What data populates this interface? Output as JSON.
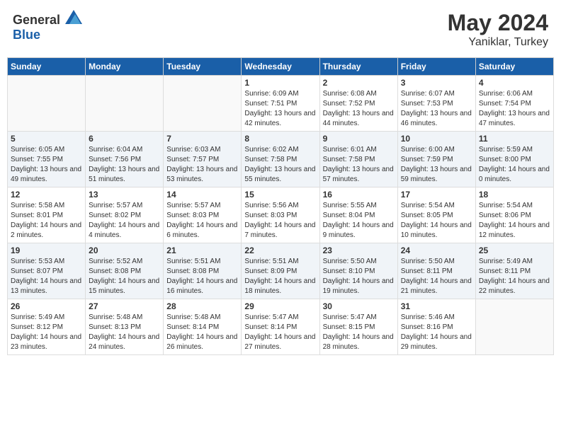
{
  "header": {
    "logo_general": "General",
    "logo_blue": "Blue",
    "month_year": "May 2024",
    "location": "Yaniklar, Turkey"
  },
  "days_of_week": [
    "Sunday",
    "Monday",
    "Tuesday",
    "Wednesday",
    "Thursday",
    "Friday",
    "Saturday"
  ],
  "weeks": [
    {
      "cells": [
        {
          "day": "",
          "empty": true
        },
        {
          "day": "",
          "empty": true
        },
        {
          "day": "",
          "empty": true
        },
        {
          "day": "1",
          "sunrise": "6:09 AM",
          "sunset": "7:51 PM",
          "daylight": "13 hours and 42 minutes."
        },
        {
          "day": "2",
          "sunrise": "6:08 AM",
          "sunset": "7:52 PM",
          "daylight": "13 hours and 44 minutes."
        },
        {
          "day": "3",
          "sunrise": "6:07 AM",
          "sunset": "7:53 PM",
          "daylight": "13 hours and 46 minutes."
        },
        {
          "day": "4",
          "sunrise": "6:06 AM",
          "sunset": "7:54 PM",
          "daylight": "13 hours and 47 minutes."
        }
      ]
    },
    {
      "cells": [
        {
          "day": "5",
          "sunrise": "6:05 AM",
          "sunset": "7:55 PM",
          "daylight": "13 hours and 49 minutes."
        },
        {
          "day": "6",
          "sunrise": "6:04 AM",
          "sunset": "7:56 PM",
          "daylight": "13 hours and 51 minutes."
        },
        {
          "day": "7",
          "sunrise": "6:03 AM",
          "sunset": "7:57 PM",
          "daylight": "13 hours and 53 minutes."
        },
        {
          "day": "8",
          "sunrise": "6:02 AM",
          "sunset": "7:58 PM",
          "daylight": "13 hours and 55 minutes."
        },
        {
          "day": "9",
          "sunrise": "6:01 AM",
          "sunset": "7:58 PM",
          "daylight": "13 hours and 57 minutes."
        },
        {
          "day": "10",
          "sunrise": "6:00 AM",
          "sunset": "7:59 PM",
          "daylight": "13 hours and 59 minutes."
        },
        {
          "day": "11",
          "sunrise": "5:59 AM",
          "sunset": "8:00 PM",
          "daylight": "14 hours and 0 minutes."
        }
      ]
    },
    {
      "cells": [
        {
          "day": "12",
          "sunrise": "5:58 AM",
          "sunset": "8:01 PM",
          "daylight": "14 hours and 2 minutes."
        },
        {
          "day": "13",
          "sunrise": "5:57 AM",
          "sunset": "8:02 PM",
          "daylight": "14 hours and 4 minutes."
        },
        {
          "day": "14",
          "sunrise": "5:57 AM",
          "sunset": "8:03 PM",
          "daylight": "14 hours and 6 minutes."
        },
        {
          "day": "15",
          "sunrise": "5:56 AM",
          "sunset": "8:03 PM",
          "daylight": "14 hours and 7 minutes."
        },
        {
          "day": "16",
          "sunrise": "5:55 AM",
          "sunset": "8:04 PM",
          "daylight": "14 hours and 9 minutes."
        },
        {
          "day": "17",
          "sunrise": "5:54 AM",
          "sunset": "8:05 PM",
          "daylight": "14 hours and 10 minutes."
        },
        {
          "day": "18",
          "sunrise": "5:54 AM",
          "sunset": "8:06 PM",
          "daylight": "14 hours and 12 minutes."
        }
      ]
    },
    {
      "cells": [
        {
          "day": "19",
          "sunrise": "5:53 AM",
          "sunset": "8:07 PM",
          "daylight": "14 hours and 13 minutes."
        },
        {
          "day": "20",
          "sunrise": "5:52 AM",
          "sunset": "8:08 PM",
          "daylight": "14 hours and 15 minutes."
        },
        {
          "day": "21",
          "sunrise": "5:51 AM",
          "sunset": "8:08 PM",
          "daylight": "14 hours and 16 minutes."
        },
        {
          "day": "22",
          "sunrise": "5:51 AM",
          "sunset": "8:09 PM",
          "daylight": "14 hours and 18 minutes."
        },
        {
          "day": "23",
          "sunrise": "5:50 AM",
          "sunset": "8:10 PM",
          "daylight": "14 hours and 19 minutes."
        },
        {
          "day": "24",
          "sunrise": "5:50 AM",
          "sunset": "8:11 PM",
          "daylight": "14 hours and 21 minutes."
        },
        {
          "day": "25",
          "sunrise": "5:49 AM",
          "sunset": "8:11 PM",
          "daylight": "14 hours and 22 minutes."
        }
      ]
    },
    {
      "cells": [
        {
          "day": "26",
          "sunrise": "5:49 AM",
          "sunset": "8:12 PM",
          "daylight": "14 hours and 23 minutes."
        },
        {
          "day": "27",
          "sunrise": "5:48 AM",
          "sunset": "8:13 PM",
          "daylight": "14 hours and 24 minutes."
        },
        {
          "day": "28",
          "sunrise": "5:48 AM",
          "sunset": "8:14 PM",
          "daylight": "14 hours and 26 minutes."
        },
        {
          "day": "29",
          "sunrise": "5:47 AM",
          "sunset": "8:14 PM",
          "daylight": "14 hours and 27 minutes."
        },
        {
          "day": "30",
          "sunrise": "5:47 AM",
          "sunset": "8:15 PM",
          "daylight": "14 hours and 28 minutes."
        },
        {
          "day": "31",
          "sunrise": "5:46 AM",
          "sunset": "8:16 PM",
          "daylight": "14 hours and 29 minutes."
        },
        {
          "day": "",
          "empty": true
        }
      ]
    }
  ]
}
